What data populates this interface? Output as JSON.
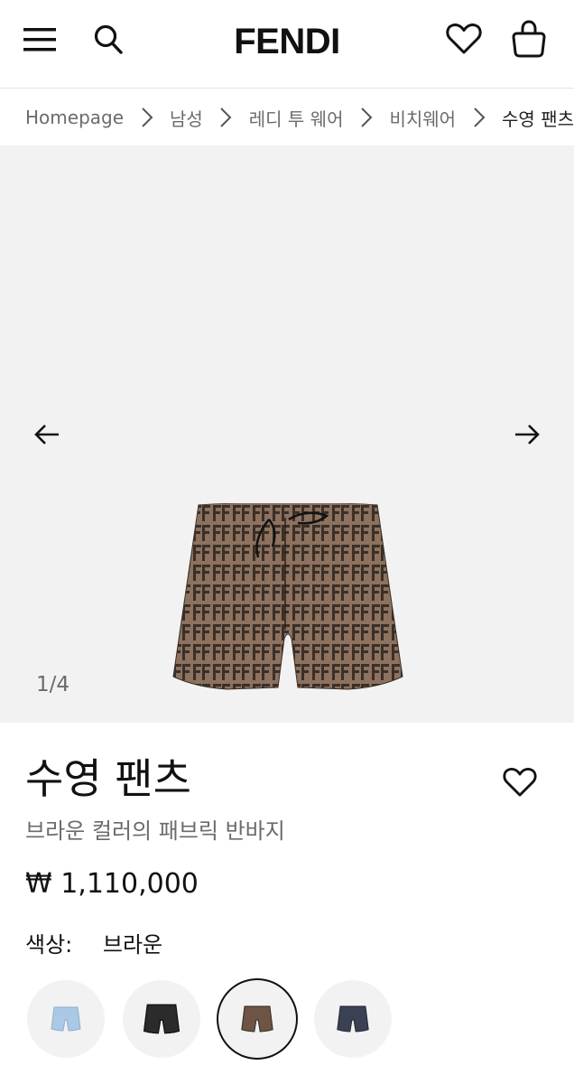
{
  "header": {
    "logo": "FENDI",
    "icons": {
      "menu": "menu-icon",
      "search": "search-icon",
      "wishlist": "heart-icon",
      "bag": "shopping-bag-icon"
    }
  },
  "breadcrumb": {
    "items": [
      "Homepage",
      "남성",
      "레디 투 웨어",
      "비치웨어",
      "수영 팬츠"
    ]
  },
  "gallery": {
    "counter": "1/4",
    "prev_icon": "arrow-left-icon",
    "next_icon": "arrow-right-icon"
  },
  "product": {
    "title": "수영 팬츠",
    "subtitle": "브라운 컬러의 패브릭 반바지",
    "price": "₩ 1,110,000",
    "color_label": "색상:",
    "color_value": "브라운"
  },
  "swatches": [
    {
      "color": "#a9c9e6",
      "selected": false
    },
    {
      "color": "#2b2b2b",
      "selected": false
    },
    {
      "color": "#6e5444",
      "selected": true
    },
    {
      "color": "#3a4152",
      "selected": false
    }
  ],
  "colors": {
    "text_primary": "#111111",
    "text_secondary": "#6b6b6b",
    "gallery_bg": "#f2f2f2",
    "ff_dark": "#3b2f27",
    "ff_light": "#8c725f"
  }
}
